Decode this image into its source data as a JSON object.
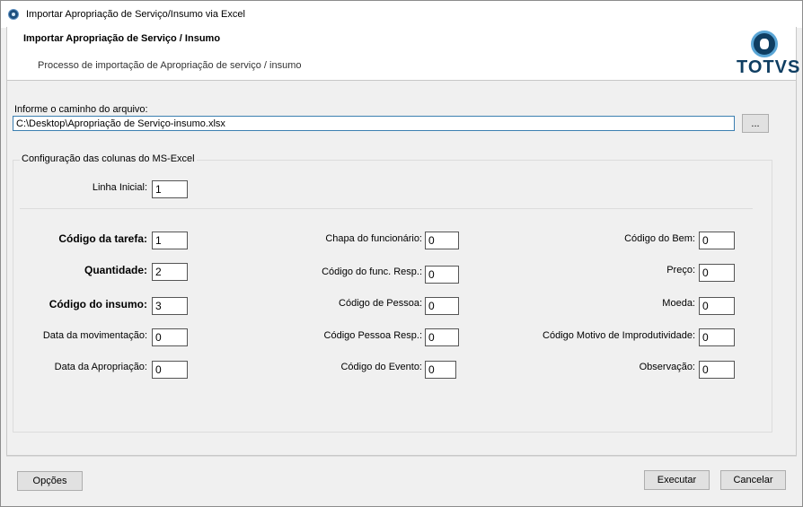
{
  "window": {
    "title": "Importar Apropriação de Serviço/Insumo via Excel"
  },
  "header": {
    "title": "Importar Apropriação de Serviço / Insumo",
    "subtitle": "Processo de importação de Apropriação de serviço / insumo",
    "logo_text": "TOTVS"
  },
  "file": {
    "label": "Informe o caminho do arquivo:",
    "path": "C:\\Desktop\\Apropriação de Serviço-insumo.xlsx",
    "browse_label": "..."
  },
  "config": {
    "group_title": "Configuração das colunas do MS-Excel",
    "linha_inicial": {
      "label": "Linha Inicial:",
      "value": "1"
    },
    "col1": [
      {
        "label": "Código da tarefa:",
        "value": "1"
      },
      {
        "label": "Quantidade:",
        "value": "2"
      },
      {
        "label": "Código do insumo:",
        "value": "3"
      },
      {
        "label": "Data da movimentação:",
        "value": "0"
      },
      {
        "label": "Data da Apropriação:",
        "value": "0"
      }
    ],
    "col2": [
      {
        "label": "Chapa do funcionário:",
        "value": "0"
      },
      {
        "label": "Código do func. Resp.:",
        "value": "0"
      },
      {
        "label": "Código de Pessoa:",
        "value": "0"
      },
      {
        "label": "Código Pessoa Resp.:",
        "value": "0"
      },
      {
        "label": "Código do Evento:",
        "value": "0"
      }
    ],
    "col3": [
      {
        "label": "Código do Bem:",
        "value": "0"
      },
      {
        "label": "Preço:",
        "value": "0"
      },
      {
        "label": "Moeda:",
        "value": "0"
      },
      {
        "label": "Código Motivo de Improdutividade:",
        "value": "0"
      },
      {
        "label": "Observação:",
        "value": "0"
      }
    ]
  },
  "footer": {
    "options_label": "Opções",
    "execute_label": "Executar",
    "cancel_label": "Cancelar"
  }
}
